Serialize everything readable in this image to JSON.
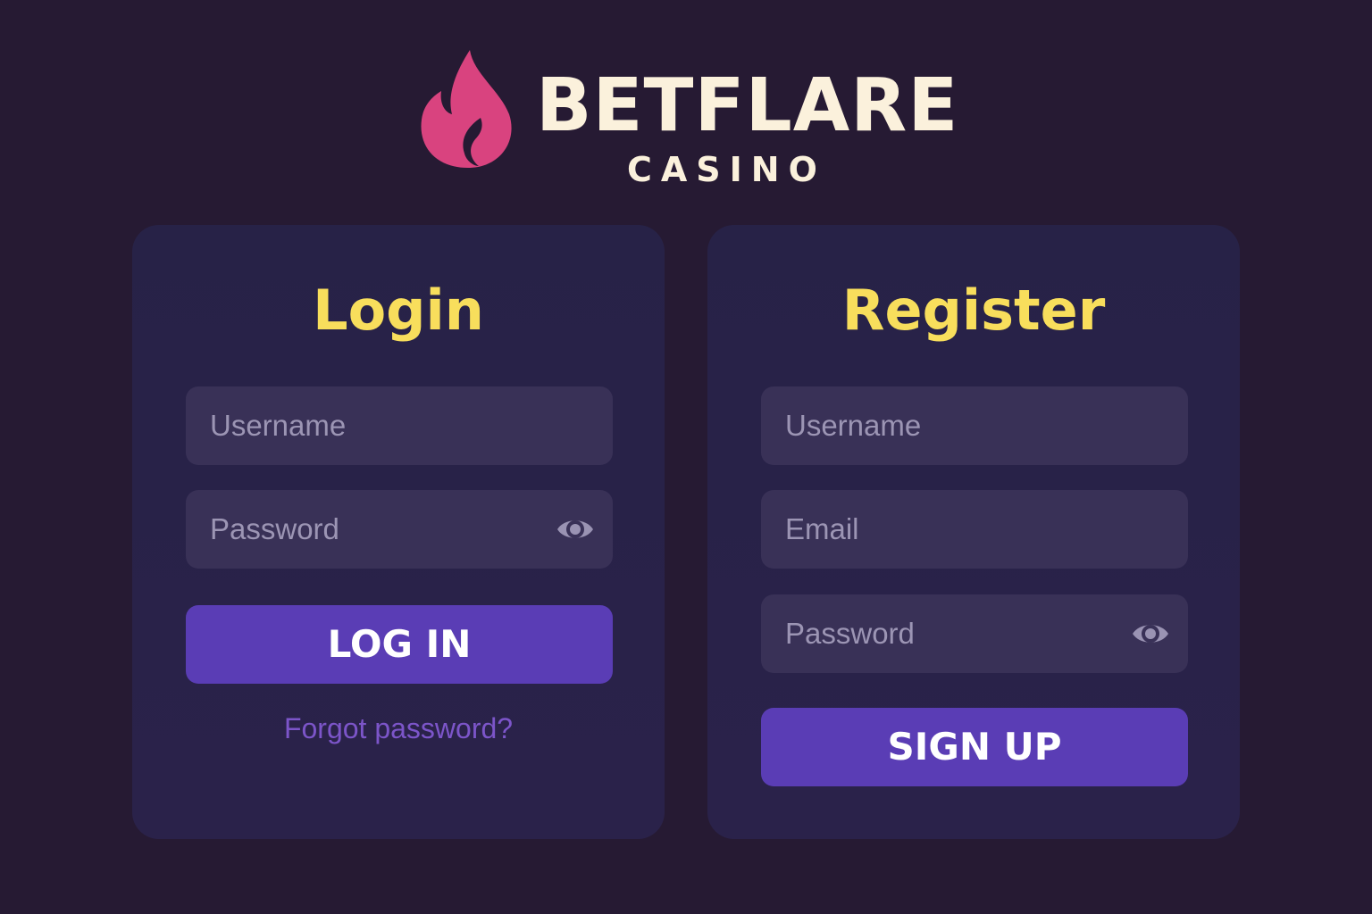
{
  "brand": {
    "name": "BETFLARE",
    "subtitle": "CASINO",
    "logo_icon": "flame-icon",
    "colors": {
      "flame": "#d9437f",
      "wordmark": "#fbf1dc"
    }
  },
  "login": {
    "title": "Login",
    "username_placeholder": "Username",
    "password_placeholder": "Password",
    "toggle_icon": "eye-icon",
    "submit_label": "LOG IN",
    "forgot_label": "Forgot password?"
  },
  "register": {
    "title": "Register",
    "username_placeholder": "Username",
    "email_placeholder": "Email",
    "password_placeholder": "Password",
    "toggle_icon": "eye-icon",
    "submit_label": "SIGN UP"
  },
  "colors": {
    "background": "#261a33",
    "card": "#272247",
    "field": "#393157",
    "title": "#f8de5c",
    "button": "#5a3db5",
    "link": "#7c55c9"
  }
}
